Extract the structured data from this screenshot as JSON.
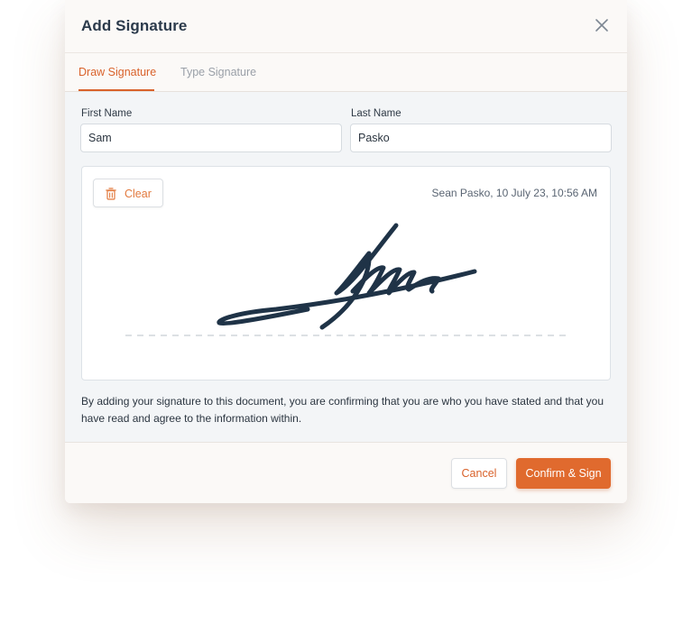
{
  "dialog": {
    "title": "Add Signature",
    "close_icon": "close-icon"
  },
  "tabs": [
    {
      "label": "Draw Signature",
      "active": true
    },
    {
      "label": "Type Signature",
      "active": false
    }
  ],
  "form": {
    "first_name_label": "First Name",
    "first_name_value": "Sam",
    "last_name_label": "Last Name",
    "last_name_value": "Pasko"
  },
  "signature_pad": {
    "clear_label": "Clear",
    "clear_icon": "trash-icon",
    "stamp": "Sean Pasko, 10 July 23, 10:56 AM",
    "ink_color": "#1f3347"
  },
  "note": "By adding your signature to this document, you are confirming that you are who you have stated and that you have read and agree to the information within.",
  "footer": {
    "cancel_label": "Cancel",
    "confirm_label": "Confirm & Sign"
  },
  "colors": {
    "accent": "#e06a2e",
    "title": "#2b3a4b"
  }
}
